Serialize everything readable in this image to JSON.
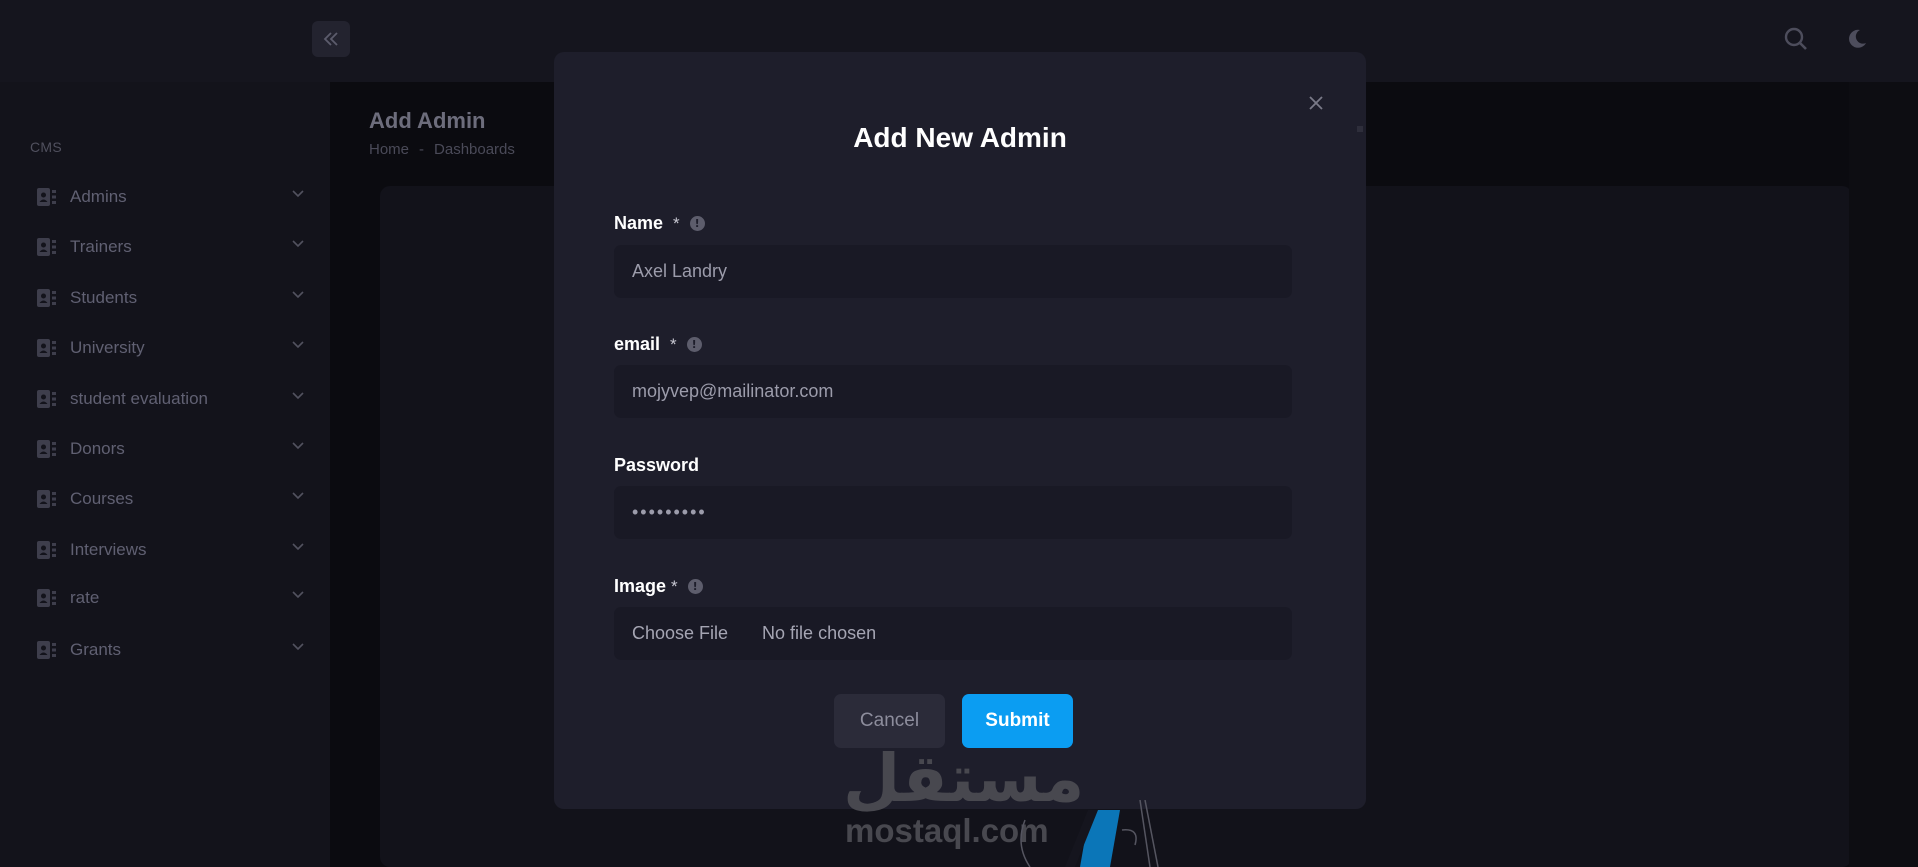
{
  "sidebar": {
    "section_label": "CMS",
    "items": [
      {
        "label": "Admins"
      },
      {
        "label": "Trainers"
      },
      {
        "label": "Students"
      },
      {
        "label": "University"
      },
      {
        "label": "student evaluation"
      },
      {
        "label": "Donors"
      },
      {
        "label": "Courses"
      },
      {
        "label": "Interviews"
      },
      {
        "label": "rate"
      },
      {
        "label": "Grants"
      }
    ]
  },
  "page": {
    "title": "Add Admin",
    "breadcrumb": [
      "Home",
      "-",
      "Dashboards"
    ]
  },
  "modal": {
    "title": "Add New Admin",
    "fields": {
      "name": {
        "label": "Name",
        "required_mark": "*",
        "value": "Axel Landry"
      },
      "email": {
        "label": "email",
        "required_mark": "*",
        "value": "mojyvep@mailinator.com"
      },
      "password": {
        "label": "Password",
        "value": "•••••••••"
      },
      "image": {
        "label": "Image",
        "required_mark": "*",
        "button": "Choose File",
        "status": "No file chosen"
      }
    },
    "cancel_label": "Cancel",
    "submit_label": "Submit"
  },
  "watermark": {
    "arabic": "مستقل",
    "latin": "mostaql.com"
  },
  "colors": {
    "accent": "#0b9df2",
    "modal_bg": "#1e1e2b",
    "page_bg": "#101016"
  },
  "icons": {
    "collapse": "double-chevron-left-icon",
    "search": "search-icon",
    "theme": "moon-icon",
    "menu_item": "contact-card-icon",
    "chevron": "chevron-down-icon",
    "close": "close-icon",
    "info": "info-icon"
  }
}
